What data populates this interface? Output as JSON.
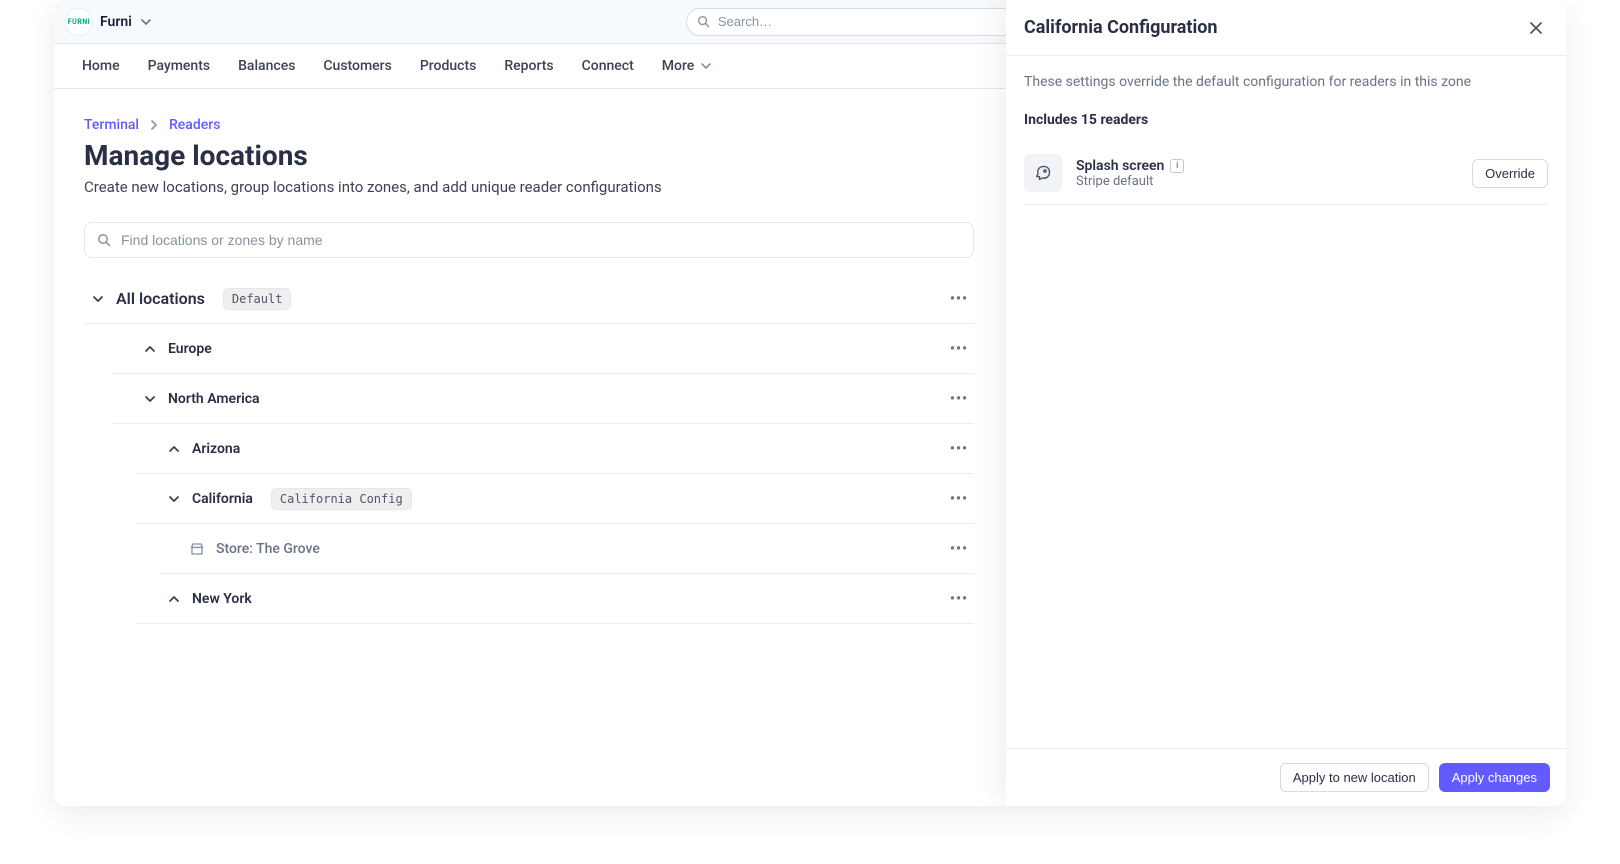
{
  "brand": {
    "logo_text": "FURNI",
    "name": "Furni"
  },
  "search": {
    "placeholder": "Search…"
  },
  "nav": {
    "items": [
      "Home",
      "Payments",
      "Balances",
      "Customers",
      "Products",
      "Reports",
      "Connect"
    ],
    "more": "More"
  },
  "crumbs": {
    "a": "Terminal",
    "b": "Readers"
  },
  "page": {
    "title": "Manage locations",
    "subtitle": "Create new locations, group locations into zones, and add unique reader configurations"
  },
  "find": {
    "placeholder": "Find locations or zones by name"
  },
  "tree": {
    "root": {
      "label": "All locations",
      "tag": "Default"
    },
    "europe": {
      "label": "Europe"
    },
    "na": {
      "label": "North America"
    },
    "az": {
      "label": "Arizona"
    },
    "ca": {
      "label": "California",
      "tag": "California Config"
    },
    "store1": {
      "label": "Store: The Grove"
    },
    "ny": {
      "label": "New York"
    }
  },
  "panel": {
    "title": "California Configuration",
    "note": "These settings override the default configuration for readers in this zone",
    "includes": "Includes 15 readers",
    "setting": {
      "title": "Splash screen",
      "sub": "Stripe default",
      "override": "Override"
    },
    "apply_new": "Apply to new location",
    "apply": "Apply changes"
  }
}
